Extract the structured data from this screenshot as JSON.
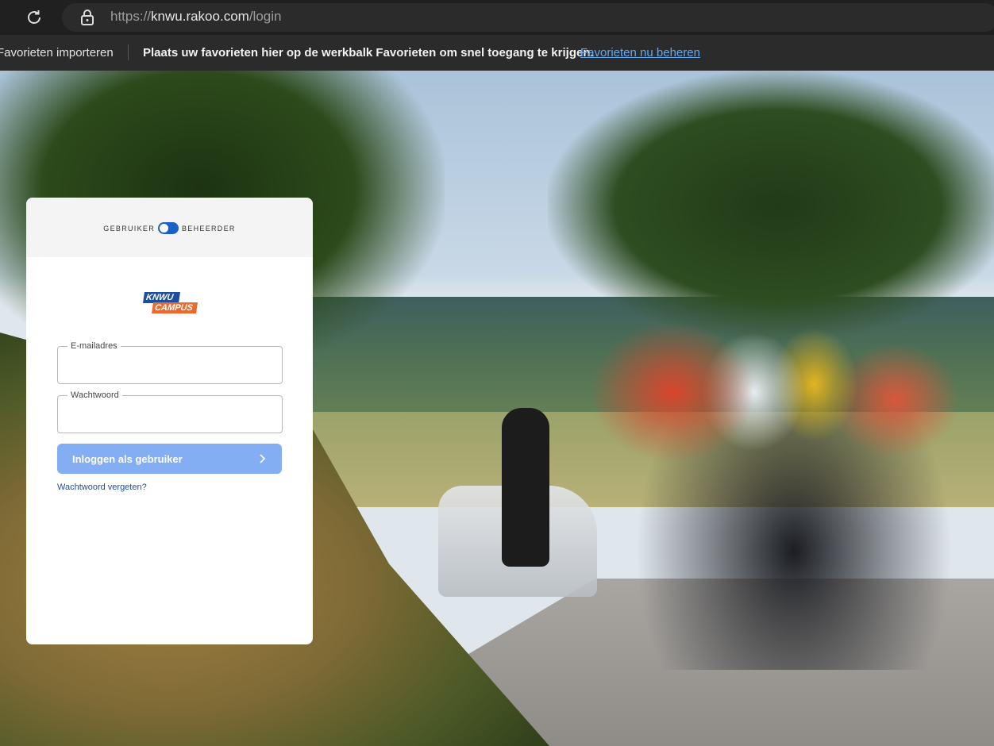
{
  "browser": {
    "url_scheme": "https://",
    "url_host": "knwu.rakoo.com",
    "url_path": "/login",
    "favorites_import": "Favorieten importeren",
    "favorites_message": "Plaats uw favorieten hier op de werkbalk Favorieten om snel toegang te krijgen.",
    "favorites_manage_link": "Favorieten nu beheren"
  },
  "login": {
    "role_left": "GEBRUIKER",
    "role_right": "BEHEERDER",
    "logo_top": "KNWU",
    "logo_bottom": "CAMPUS",
    "email_label": "E-mailadres",
    "email_value": "",
    "password_label": "Wachtwoord",
    "password_value": "",
    "submit_label": "Inloggen als gebruiker",
    "forgot_link": "Wachtwoord vergeten?"
  },
  "colors": {
    "toggle": "#1b5fc8",
    "button": "#84aef3",
    "link": "#1f4f99",
    "logo_blue": "#1c4ea1",
    "logo_orange": "#f0682a"
  }
}
